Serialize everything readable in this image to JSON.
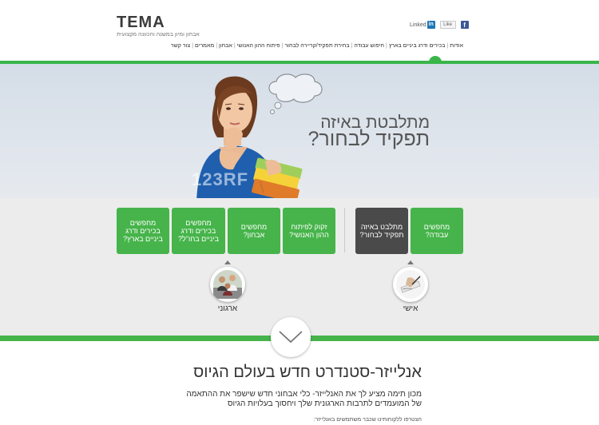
{
  "header": {
    "logo": {
      "word": "TEMA",
      "tagline": "אבחון ומיון במשנה והכוונה מקצועית"
    },
    "social": {
      "linkedin_label": "Linked",
      "like_label": "Like",
      "facebook_label": "f",
      "linkedin_icon_label": "in"
    },
    "nav_items": [
      "אודות",
      "בכירים ודרג ביניים בארץ",
      "חיפוש עבודה",
      "בחירת תפקיד/קריירה לבחור",
      "פיתוח ההון האנושי",
      "אבחון",
      "מאמרים",
      "צור קשר"
    ]
  },
  "hero": {
    "line1": "מתלבטת באיזה",
    "line2": "תפקיד לבחור?",
    "watermark": "123RF"
  },
  "tiles": {
    "personal": [
      {
        "label": "מחפשים עבודה?"
      },
      {
        "label": "מתלבט באיזה תפקיד לבחור?"
      }
    ],
    "organizational": [
      {
        "label": "זקוק לפיתוח ההון האנושי?"
      },
      {
        "label": "מחפשים אבחון?"
      },
      {
        "label": "מחפשים בכירים ודרג ביניים בחו\"ל?"
      },
      {
        "label": "מחפשים בכירים ודרג ביניים בארץ?"
      }
    ],
    "circle_personal_label": "אישי",
    "circle_org_label": "ארגוני"
  },
  "content": {
    "title": "אנלייזר-סטנדרט חדש בעולם הגיוס",
    "p1": "מכון תימה מציע לך את האנלייזר- כלי אבחוני חדש שישפר את ההתאמה",
    "p2": "של המועמדים לתרבות הארגונית שלך ויחסוך בעלויות הגיוס",
    "p3": "הצטרפו ללקוחותינו שכבר משתמשים באנלייזר:"
  },
  "colors": {
    "brand_green": "#46b44a",
    "dark_tile": "#4a4a4a",
    "hero_bg": "#d9e1ea"
  }
}
